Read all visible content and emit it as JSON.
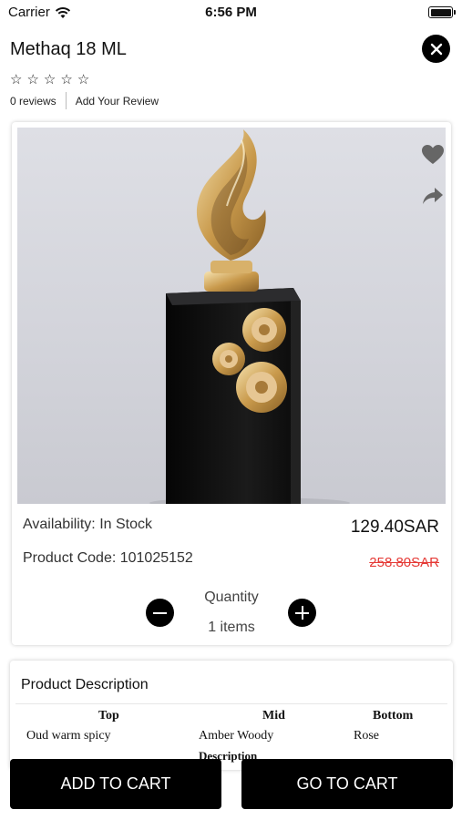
{
  "status_bar": {
    "carrier": "Carrier",
    "time": "6:56 PM",
    "icons": [
      "wifi-icon",
      "battery-icon"
    ]
  },
  "header": {
    "title": "Methaq 18 ML",
    "rating_stars": 0,
    "max_stars": 5,
    "reviews_count": "0 reviews",
    "add_review": "Add Your Review",
    "close_icon": "close-icon"
  },
  "product": {
    "image_alt_icons": [
      "heart-icon",
      "share-icon"
    ],
    "availability": "Availability: In Stock",
    "product_code": "Product Code: 101025152",
    "price": "129.40SAR",
    "old_price": "258.80SAR",
    "quantity_label": "Quantity",
    "quantity_value": "1 items"
  },
  "description": {
    "title": "Product Description",
    "headers": [
      "Top",
      "Mid",
      "Bottom"
    ],
    "row": [
      "Oud warm spicy",
      "Amber Woody",
      "Rose"
    ],
    "next_label": "Description"
  },
  "actions": {
    "add_to_cart": "ADD TO CART",
    "go_to_cart": "GO TO CART"
  },
  "colors": {
    "accent": "#000000",
    "old_price": "#e53935",
    "background": "#ffffff"
  }
}
